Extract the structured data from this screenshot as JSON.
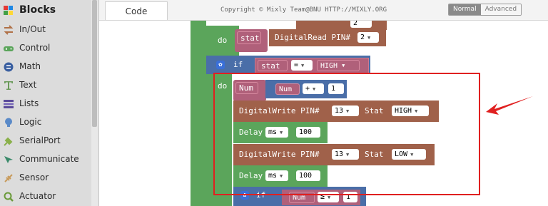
{
  "sidebar": {
    "title": "Blocks",
    "categories": [
      {
        "label": "In/Out",
        "icon": "in-out-icon",
        "color": "#b07046"
      },
      {
        "label": "Control",
        "icon": "gamepad-icon",
        "color": "#5ba55b"
      },
      {
        "label": "Math",
        "icon": "math-icon",
        "color": "#3a5fa0"
      },
      {
        "label": "Text",
        "icon": "text-icon",
        "color": "#6a9a5a"
      },
      {
        "label": "Lists",
        "icon": "lists-icon",
        "color": "#5a4a9a"
      },
      {
        "label": "Logic",
        "icon": "logic-icon",
        "color": "#5a8ac8"
      },
      {
        "label": "SerialPort",
        "icon": "serialport-icon",
        "color": "#8ab04a"
      },
      {
        "label": "Communicate",
        "icon": "communicate-icon",
        "color": "#3a8a6a"
      },
      {
        "label": "Sensor",
        "icon": "sensor-icon",
        "color": "#c89a5a"
      },
      {
        "label": "Actuator",
        "icon": "actuator-icon",
        "color": "#6a9a3a"
      }
    ]
  },
  "header": {
    "tab_code": "Code",
    "copyright": "Copyright © Mixly Team@BNU HTTP://MIXLY.ORG",
    "mode_normal": "Normal",
    "mode_advanced": "Advanced"
  },
  "workspace": {
    "do1": "do",
    "stat_var": "stat",
    "digital_read": "DigitalRead PIN#",
    "pin_read": "2",
    "if1": "if",
    "cond_var": "stat",
    "cond_op": "=",
    "cond_val": "HIGH",
    "do2": "do",
    "num_var": "Num",
    "num_expr_var": "Num",
    "num_expr_op": "+",
    "num_expr_val": "1",
    "dw1_label": "DigitalWrite PIN#",
    "dw1_pin": "13",
    "dw1_stat_label": "Stat",
    "dw1_stat": "HIGH",
    "delay1_label": "Delay",
    "delay1_unit": "ms",
    "delay1_val": "100",
    "dw2_label": "DigitalWrite PIN#",
    "dw2_pin": "13",
    "dw2_stat_label": "Stat",
    "dw2_stat": "LOW",
    "delay2_label": "Delay",
    "delay2_unit": "ms",
    "delay2_val": "100",
    "if2": "if",
    "if2_var": "Num",
    "if2_op": "≥",
    "if2_val": "1",
    "top_partial_pin": "2"
  },
  "colors": {
    "green_block": "#5ba55b",
    "brown_block": "#a0614a",
    "blue_block": "#4a6ea8",
    "pink_block": "#b0607a",
    "annotation_red": "#e02020"
  }
}
